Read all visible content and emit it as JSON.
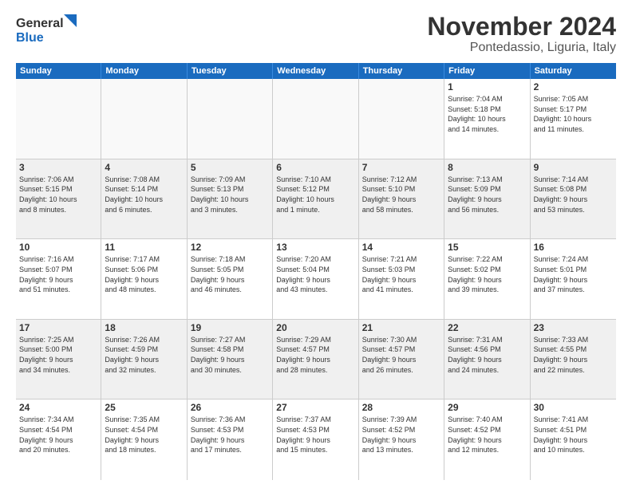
{
  "logo": {
    "line1": "General",
    "line2": "Blue"
  },
  "title": "November 2024",
  "location": "Pontedassio, Liguria, Italy",
  "header_days": [
    "Sunday",
    "Monday",
    "Tuesday",
    "Wednesday",
    "Thursday",
    "Friday",
    "Saturday"
  ],
  "weeks": [
    [
      {
        "day": "",
        "info": "",
        "empty": true
      },
      {
        "day": "",
        "info": "",
        "empty": true
      },
      {
        "day": "",
        "info": "",
        "empty": true
      },
      {
        "day": "",
        "info": "",
        "empty": true
      },
      {
        "day": "",
        "info": "",
        "empty": true
      },
      {
        "day": "1",
        "info": "Sunrise: 7:04 AM\nSunset: 5:18 PM\nDaylight: 10 hours\nand 14 minutes.",
        "empty": false
      },
      {
        "day": "2",
        "info": "Sunrise: 7:05 AM\nSunset: 5:17 PM\nDaylight: 10 hours\nand 11 minutes.",
        "empty": false
      }
    ],
    [
      {
        "day": "3",
        "info": "Sunrise: 7:06 AM\nSunset: 5:15 PM\nDaylight: 10 hours\nand 8 minutes.",
        "empty": false
      },
      {
        "day": "4",
        "info": "Sunrise: 7:08 AM\nSunset: 5:14 PM\nDaylight: 10 hours\nand 6 minutes.",
        "empty": false
      },
      {
        "day": "5",
        "info": "Sunrise: 7:09 AM\nSunset: 5:13 PM\nDaylight: 10 hours\nand 3 minutes.",
        "empty": false
      },
      {
        "day": "6",
        "info": "Sunrise: 7:10 AM\nSunset: 5:12 PM\nDaylight: 10 hours\nand 1 minute.",
        "empty": false
      },
      {
        "day": "7",
        "info": "Sunrise: 7:12 AM\nSunset: 5:10 PM\nDaylight: 9 hours\nand 58 minutes.",
        "empty": false
      },
      {
        "day": "8",
        "info": "Sunrise: 7:13 AM\nSunset: 5:09 PM\nDaylight: 9 hours\nand 56 minutes.",
        "empty": false
      },
      {
        "day": "9",
        "info": "Sunrise: 7:14 AM\nSunset: 5:08 PM\nDaylight: 9 hours\nand 53 minutes.",
        "empty": false
      }
    ],
    [
      {
        "day": "10",
        "info": "Sunrise: 7:16 AM\nSunset: 5:07 PM\nDaylight: 9 hours\nand 51 minutes.",
        "empty": false
      },
      {
        "day": "11",
        "info": "Sunrise: 7:17 AM\nSunset: 5:06 PM\nDaylight: 9 hours\nand 48 minutes.",
        "empty": false
      },
      {
        "day": "12",
        "info": "Sunrise: 7:18 AM\nSunset: 5:05 PM\nDaylight: 9 hours\nand 46 minutes.",
        "empty": false
      },
      {
        "day": "13",
        "info": "Sunrise: 7:20 AM\nSunset: 5:04 PM\nDaylight: 9 hours\nand 43 minutes.",
        "empty": false
      },
      {
        "day": "14",
        "info": "Sunrise: 7:21 AM\nSunset: 5:03 PM\nDaylight: 9 hours\nand 41 minutes.",
        "empty": false
      },
      {
        "day": "15",
        "info": "Sunrise: 7:22 AM\nSunset: 5:02 PM\nDaylight: 9 hours\nand 39 minutes.",
        "empty": false
      },
      {
        "day": "16",
        "info": "Sunrise: 7:24 AM\nSunset: 5:01 PM\nDaylight: 9 hours\nand 37 minutes.",
        "empty": false
      }
    ],
    [
      {
        "day": "17",
        "info": "Sunrise: 7:25 AM\nSunset: 5:00 PM\nDaylight: 9 hours\nand 34 minutes.",
        "empty": false
      },
      {
        "day": "18",
        "info": "Sunrise: 7:26 AM\nSunset: 4:59 PM\nDaylight: 9 hours\nand 32 minutes.",
        "empty": false
      },
      {
        "day": "19",
        "info": "Sunrise: 7:27 AM\nSunset: 4:58 PM\nDaylight: 9 hours\nand 30 minutes.",
        "empty": false
      },
      {
        "day": "20",
        "info": "Sunrise: 7:29 AM\nSunset: 4:57 PM\nDaylight: 9 hours\nand 28 minutes.",
        "empty": false
      },
      {
        "day": "21",
        "info": "Sunrise: 7:30 AM\nSunset: 4:57 PM\nDaylight: 9 hours\nand 26 minutes.",
        "empty": false
      },
      {
        "day": "22",
        "info": "Sunrise: 7:31 AM\nSunset: 4:56 PM\nDaylight: 9 hours\nand 24 minutes.",
        "empty": false
      },
      {
        "day": "23",
        "info": "Sunrise: 7:33 AM\nSunset: 4:55 PM\nDaylight: 9 hours\nand 22 minutes.",
        "empty": false
      }
    ],
    [
      {
        "day": "24",
        "info": "Sunrise: 7:34 AM\nSunset: 4:54 PM\nDaylight: 9 hours\nand 20 minutes.",
        "empty": false
      },
      {
        "day": "25",
        "info": "Sunrise: 7:35 AM\nSunset: 4:54 PM\nDaylight: 9 hours\nand 18 minutes.",
        "empty": false
      },
      {
        "day": "26",
        "info": "Sunrise: 7:36 AM\nSunset: 4:53 PM\nDaylight: 9 hours\nand 17 minutes.",
        "empty": false
      },
      {
        "day": "27",
        "info": "Sunrise: 7:37 AM\nSunset: 4:53 PM\nDaylight: 9 hours\nand 15 minutes.",
        "empty": false
      },
      {
        "day": "28",
        "info": "Sunrise: 7:39 AM\nSunset: 4:52 PM\nDaylight: 9 hours\nand 13 minutes.",
        "empty": false
      },
      {
        "day": "29",
        "info": "Sunrise: 7:40 AM\nSunset: 4:52 PM\nDaylight: 9 hours\nand 12 minutes.",
        "empty": false
      },
      {
        "day": "30",
        "info": "Sunrise: 7:41 AM\nSunset: 4:51 PM\nDaylight: 9 hours\nand 10 minutes.",
        "empty": false
      }
    ]
  ]
}
